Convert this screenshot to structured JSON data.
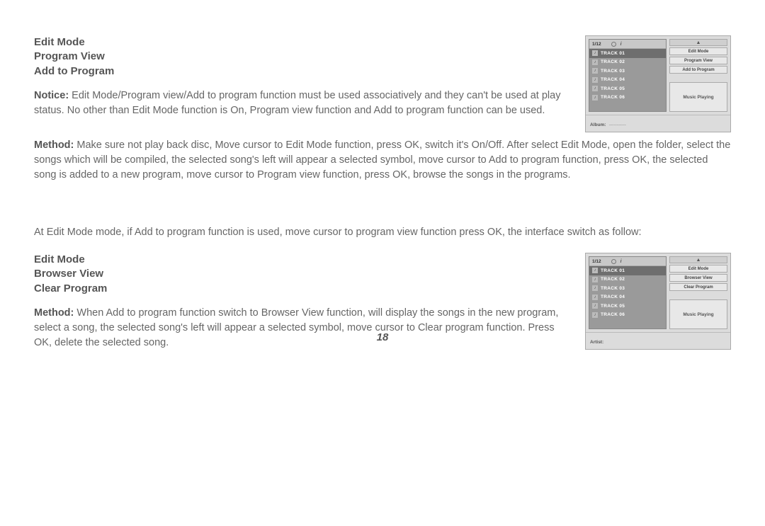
{
  "section1": {
    "titles": [
      "Edit Mode",
      "Program View",
      "Add to Program"
    ],
    "notice_label": "Notice:",
    "notice_body": " Edit Mode/Program view/Add to program function must be used associatively and they can't be used at play status. No other than Edit Mode function is On, Program view function and Add to program function can be used.",
    "method_label": "Method:",
    "method_body": " Make sure not play back disc, Move cursor to Edit Mode function, press OK, switch it's On/Off. After select Edit Mode, open the folder, select the songs which will be compiled, the selected song's left will appear a selected symbol, move cursor to Add to program function, press OK, the selected song is added to a new program, move cursor to Program view function, press OK, browse the songs in the programs."
  },
  "mid_para": "At Edit Mode mode, if Add to program function is used, move cursor to program view function press OK, the interface switch as follow:",
  "section2": {
    "titles": [
      "Edit Mode",
      "Browser View",
      "Clear Program"
    ],
    "method_label": "Method:",
    "method_body": " When Add to program function switch to Browser View function, will display the songs in the new program, select a song, the selected song's left will appear a selected symbol, move cursor to Clear program function. Press OK, delete the selected song."
  },
  "panel1": {
    "counter": "1/12",
    "tracks": [
      "TRACK 01",
      "TRACK 02",
      "TRACK 03",
      "TRACK 04",
      "TRACK 05",
      "TRACK 06"
    ],
    "menu": [
      "Edit  Mode",
      "Program View",
      "Add to Program"
    ],
    "status": "Music Playing",
    "footer_label": "Album:",
    "footer_value": "-----------"
  },
  "panel2": {
    "counter": "1/12",
    "tracks": [
      "TRACK 01",
      "TRACK 02",
      "TRACK 03",
      "TRACK 04",
      "TRACK 05",
      "TRACK 06"
    ],
    "menu": [
      "Edit  Mode",
      "Browser View",
      "Clear Program"
    ],
    "status": "Music Playing",
    "footer_label": "Artist:",
    "footer_value": ""
  },
  "page_number": "18"
}
